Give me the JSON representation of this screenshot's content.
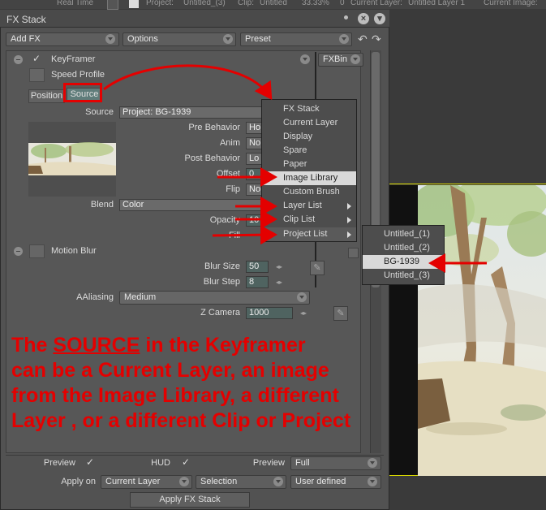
{
  "topbar": {
    "real_time": "Real Time",
    "project": "Project:",
    "project_value": "Untitled_(3)",
    "clip": "Clip:",
    "clip_value": "Untitled",
    "zoom": "33.33%",
    "frame": "0",
    "current_layer": "Current Layer:",
    "current_layer_value": "Untitled Layer 1",
    "current_image": "Current Image:"
  },
  "window": {
    "title": "FX Stack"
  },
  "toolbar": {
    "add_fx": "Add FX",
    "options": "Options",
    "preset": "Preset"
  },
  "keyframer": {
    "name": "KeyFramer",
    "speed_profile": "Speed Profile",
    "fxbin": "FXBin",
    "tab_position": "Position",
    "tab_source": "Source"
  },
  "source": {
    "label": "Source",
    "value": "Project: BG-1939",
    "pre_behavior_label": "Pre Behavior",
    "pre_behavior_value": "Ho",
    "anim_label": "Anim",
    "anim_value": "No",
    "post_behavior_label": "Post Behavior",
    "post_behavior_value": "Lo",
    "offset_label": "Offset",
    "offset_value": "0",
    "flip_label": "Flip",
    "flip_value": "No",
    "blend_label": "Blend",
    "blend_value": "Color",
    "opacity_label": "Opacity",
    "opacity_value": "10",
    "fill_label": "Fill"
  },
  "motion_blur": {
    "name": "Motion Blur",
    "blur_size_label": "Blur Size",
    "blur_size_value": "50",
    "blur_step_label": "Blur Step",
    "blur_step_value": "8",
    "aaliasing_label": "AAliasing",
    "aaliasing_value": "Medium",
    "z_camera_label": "Z Camera",
    "z_camera_value": "1000"
  },
  "menu": {
    "items": [
      "FX Stack",
      "Current Layer",
      "Display",
      "Spare",
      "Paper",
      "Image Library",
      "Custom Brush",
      "Layer List",
      "Clip List",
      "Project List"
    ]
  },
  "submenu": {
    "items": [
      "Untitled_(1)",
      "Untitled_(2)",
      "BG-1939",
      "Untitled_(3)"
    ]
  },
  "annotation": {
    "line1_pre": "The ",
    "line1_u": "SOURCE",
    "line1_post": " in the Keyframer",
    "line2": "can be a Current Layer, an image",
    "line3": "from the Image Library, a different",
    "line4": "Layer , or a different Clip or Project"
  },
  "footer": {
    "preview_label": "Preview",
    "hud_label": "HUD",
    "preview2_label": "Preview",
    "preview2_value": "Full",
    "apply_on_label": "Apply on",
    "apply_on_value": "Current Layer",
    "selection_value": "Selection",
    "user_defined_value": "User defined",
    "apply_button": "Apply FX Stack"
  },
  "colors": {
    "annotation": "#e40000",
    "panel": "#575757",
    "highlight": "#d9d9d9"
  }
}
